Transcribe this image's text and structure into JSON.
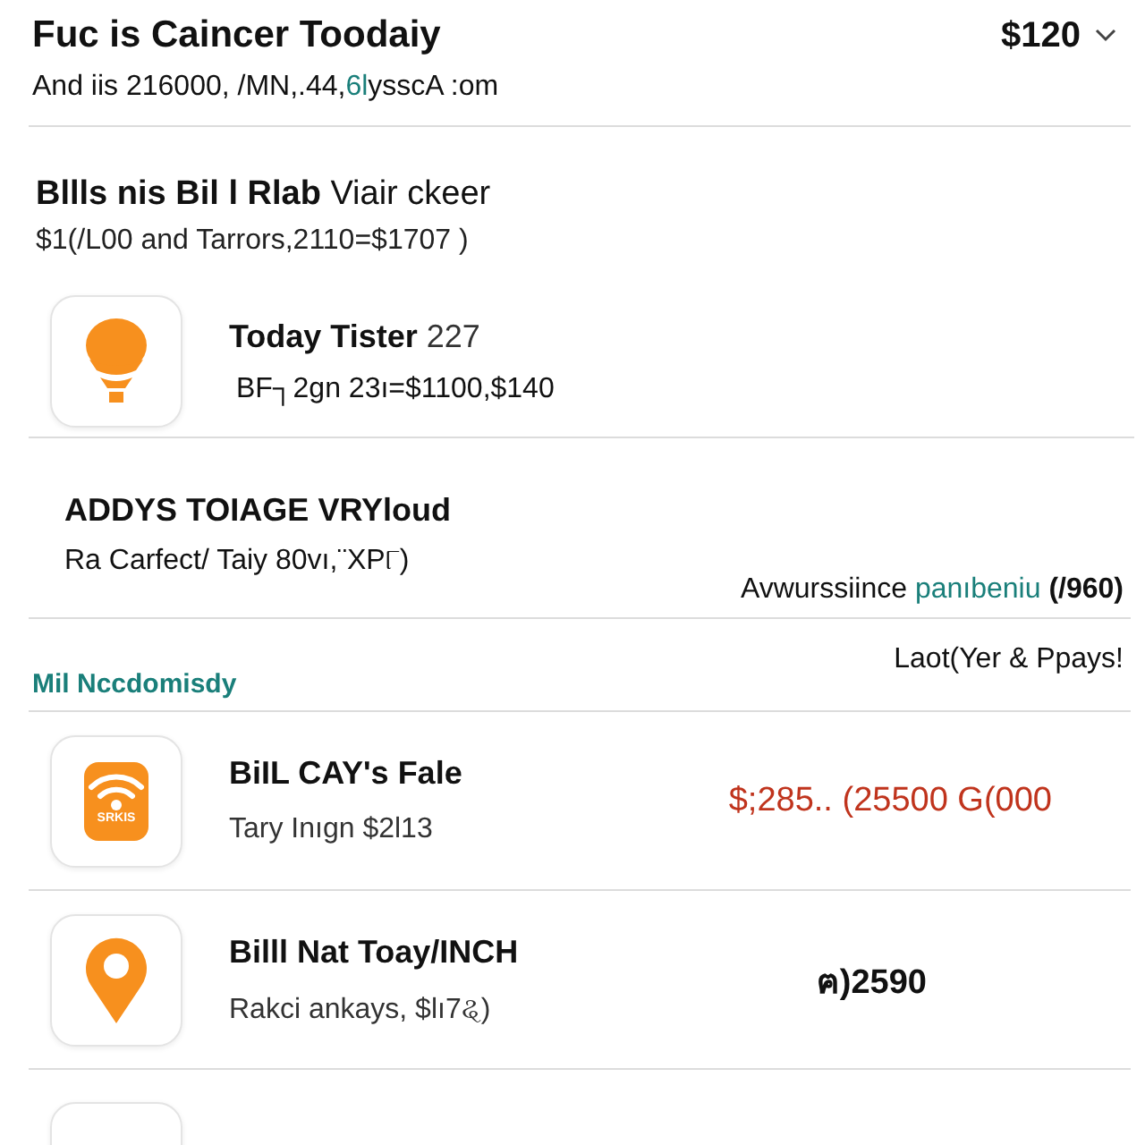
{
  "header": {
    "title": "Fuc is Caincer Toodaiy",
    "amount": "$120",
    "subtitle": [
      {
        "text": "And iis 216000, /MN,.44,",
        "kind": "plain"
      },
      {
        "text": "6l",
        "kind": "accent"
      },
      {
        "text": "ysscA :om",
        "kind": "plain"
      }
    ]
  },
  "summary": {
    "title": "**Bllls nis Bil l Rlab** Viair ckeer",
    "detail": "$1(/L00 and Tarrors,2110=$1707 )"
  },
  "featured": {
    "kind": "balloon",
    "title": "Today Tister",
    "count": "227",
    "detail": "BF┐2gn 23ı=$1100,$140"
  },
  "notice": {
    "title": "ADDYS TOIAGE VRYloud",
    "detail": "Ra Carfect/ Taiy 80vı,¨XP୮)",
    "note": [
      {
        "text": "Avwurssiince ",
        "kind": "plain"
      },
      {
        "text": "panıbeniu",
        "kind": "accent"
      },
      {
        "text": "  (/960)",
        "kind": "bold"
      }
    ]
  },
  "section": {
    "title": "Mil Nccdomisdy",
    "action": "Laot(Yer & Ppays!"
  },
  "bills": [
    {
      "kind": "wifi",
      "icon_text": "SRKIS",
      "title": "BiIL CAY's Fale",
      "detail": "Tary Inıgn $2l13",
      "amount": "$;285.. (25500 G(000",
      "color": "#c0341d"
    },
    {
      "kind": "pin",
      "title": "Billl Nat Toay/INCH",
      "detail": "Rakci ankays, $lı7ୡ)",
      "amount": "ฅ)2590",
      "color": "#111111"
    }
  ]
}
